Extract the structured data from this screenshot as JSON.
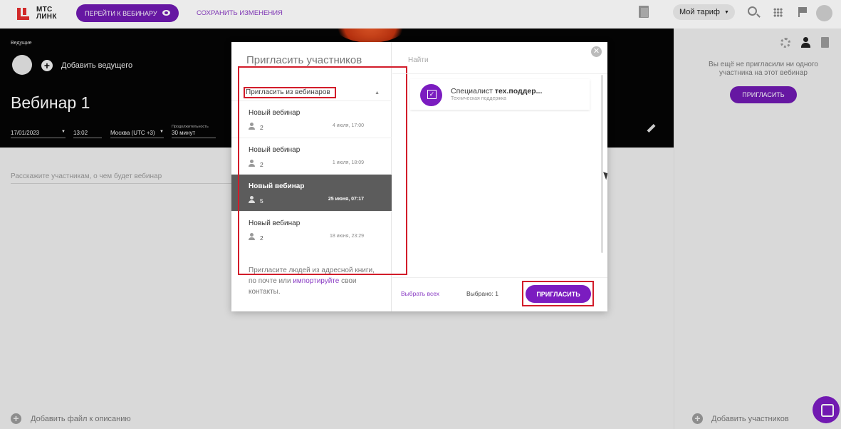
{
  "topbar": {
    "logo_line1": "МТС",
    "logo_line2": "ЛИНК",
    "goto_webinar": "ПЕРЕЙТИ К ВЕБИНАРУ",
    "save_changes": "СОХРАНИТЬ ИЗМЕНЕНИЯ",
    "tariff": "Мой тариф"
  },
  "editor": {
    "hosts_label": "Ведущие",
    "add_host": "Добавить ведущего",
    "title": "Вебинар 1",
    "date": "17/01/2023",
    "time": "13:02",
    "timezone": "Москва (UTC +3)",
    "duration_label": "Продолжительность",
    "duration": "30 минут",
    "description_placeholder": "Расскажите участникам, о чем будет вебинар",
    "add_file": "Добавить файл к описанию"
  },
  "right_panel": {
    "no_invited": "Вы ещё не пригласили ни одного участника на этот вебинар",
    "invite": "ПРИГЛАСИТЬ",
    "add_participants": "Добавить участников"
  },
  "modal": {
    "title": "Пригласить участников",
    "source": "Пригласить из вебинаров",
    "webinars": [
      {
        "name": "Новый вебинар",
        "count": "2",
        "date": "4 июля, 17:00"
      },
      {
        "name": "Новый вебинар",
        "count": "2",
        "date": "1 июля, 18:09"
      },
      {
        "name": "Новый вебинар",
        "count": "5",
        "date": "25 июня, 07:17"
      },
      {
        "name": "Новый вебинар",
        "count": "2",
        "date": "18 июня, 23:29"
      }
    ],
    "hint_text": "Пригласите людей из адресной книги, по почте или",
    "hint_link": "импортируйте",
    "hint_tail": "свои контакты.",
    "search_placeholder": "Найти",
    "contact": {
      "name_prefix": "Специалист",
      "name_bold": "тех.поддер...",
      "role": "Техническая поддержка"
    },
    "select_all": "Выбрать всех",
    "selected": "Выбрано: 1",
    "invite": "ПРИГЛАСИТЬ"
  },
  "colors": {
    "accent": "#7b1cc0",
    "highlight": "#d21c2a",
    "brand_red": "#e32e2e"
  }
}
